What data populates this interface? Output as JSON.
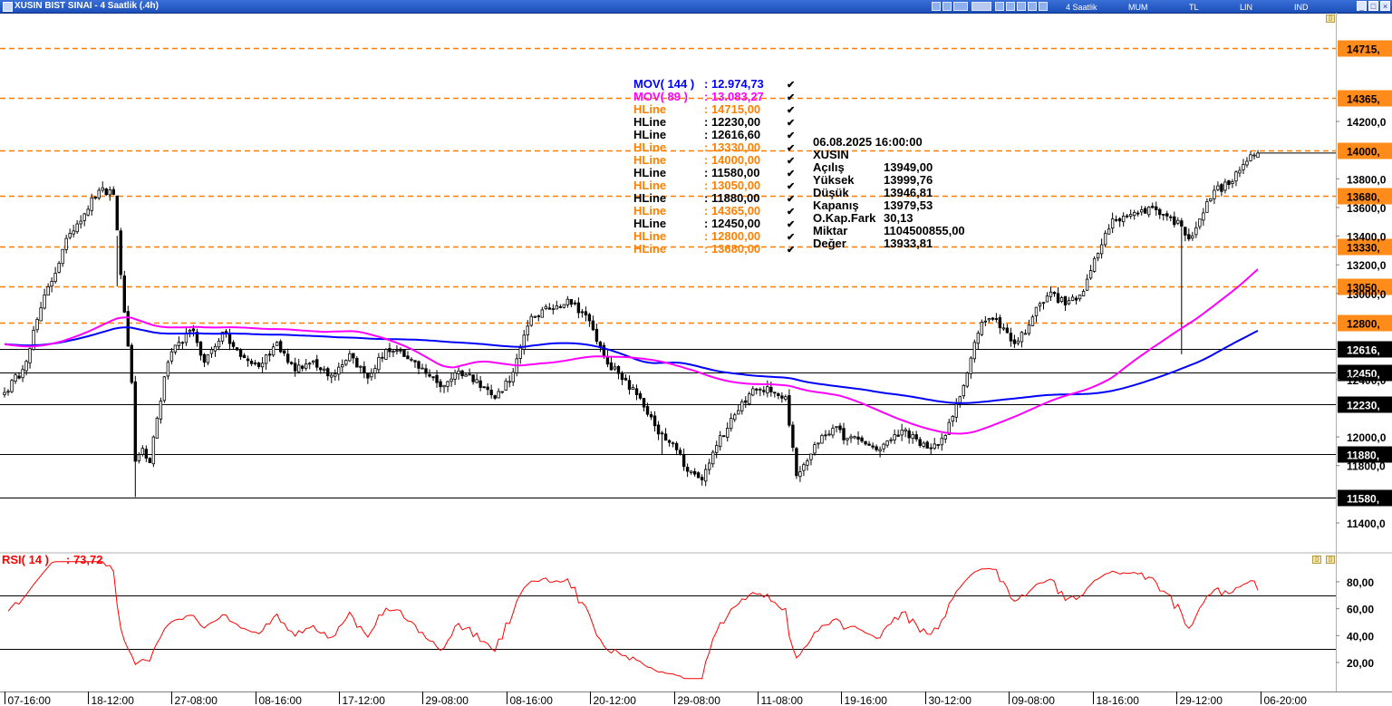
{
  "window": {
    "title": "XUSIN BIST SINAI - 4 Saatlik (.4h)",
    "toolbar": {
      "period": "4 Saatlik",
      "style": "MUM",
      "currency": "TL",
      "scale": "LIN",
      "indicators": "IND"
    }
  },
  "chart_data": {
    "type": "candlestick",
    "symbol": "XUSIN",
    "price_ticks": [
      "14200,0",
      "14000,",
      "13800,0",
      "13600,0",
      "13400,0",
      "13200,0",
      "13000,0",
      "12400,0",
      "12000,0",
      "11800,0",
      "11400,0"
    ],
    "x_labels": [
      "07-16:00",
      "18-12:00",
      "27-08:00",
      "08-16:00",
      "17-12:00",
      "29-08:00",
      "08-16:00",
      "20-12:00",
      "29-08:00",
      "11-08:00",
      "19-16:00",
      "30-12:00",
      "09-08:00",
      "18-16:00",
      "29-12:00",
      "06-20:00"
    ],
    "close_anchors": [
      [
        0,
        12310
      ],
      [
        5,
        12470
      ],
      [
        10,
        12900
      ],
      [
        18,
        13420
      ],
      [
        26,
        13720
      ],
      [
        30,
        13690
      ],
      [
        33,
        12870
      ],
      [
        35,
        12380
      ],
      [
        36,
        11830
      ],
      [
        38,
        11920
      ],
      [
        40,
        11820
      ],
      [
        42,
        12130
      ],
      [
        45,
        12520
      ],
      [
        48,
        12660
      ],
      [
        52,
        12740
      ],
      [
        55,
        12520
      ],
      [
        60,
        12730
      ],
      [
        65,
        12560
      ],
      [
        70,
        12490
      ],
      [
        75,
        12660
      ],
      [
        80,
        12460
      ],
      [
        85,
        12530
      ],
      [
        90,
        12430
      ],
      [
        95,
        12580
      ],
      [
        100,
        12410
      ],
      [
        105,
        12610
      ],
      [
        110,
        12560
      ],
      [
        115,
        12480
      ],
      [
        120,
        12350
      ],
      [
        125,
        12460
      ],
      [
        130,
        12400
      ],
      [
        135,
        12270
      ],
      [
        140,
        12450
      ],
      [
        145,
        12840
      ],
      [
        150,
        12890
      ],
      [
        155,
        12960
      ],
      [
        160,
        12850
      ],
      [
        165,
        12560
      ],
      [
        170,
        12400
      ],
      [
        175,
        12270
      ],
      [
        180,
        12020
      ],
      [
        185,
        11910
      ],
      [
        188,
        11760
      ],
      [
        192,
        11700
      ],
      [
        196,
        11940
      ],
      [
        200,
        12130
      ],
      [
        205,
        12300
      ],
      [
        210,
        12350
      ],
      [
        215,
        12280
      ],
      [
        218,
        11730
      ],
      [
        222,
        11880
      ],
      [
        225,
        12010
      ],
      [
        228,
        12060
      ],
      [
        232,
        11990
      ],
      [
        236,
        11970
      ],
      [
        240,
        11910
      ],
      [
        244,
        11980
      ],
      [
        248,
        12050
      ],
      [
        252,
        11940
      ],
      [
        255,
        11920
      ],
      [
        259,
        12010
      ],
      [
        263,
        12280
      ],
      [
        266,
        12550
      ],
      [
        269,
        12800
      ],
      [
        272,
        12820
      ],
      [
        275,
        12760
      ],
      [
        278,
        12650
      ],
      [
        282,
        12780
      ],
      [
        285,
        12930
      ],
      [
        288,
        13010
      ],
      [
        292,
        12920
      ],
      [
        296,
        12990
      ],
      [
        298,
        13100
      ],
      [
        302,
        13340
      ],
      [
        305,
        13520
      ],
      [
        308,
        13540
      ],
      [
        312,
        13560
      ],
      [
        316,
        13600
      ],
      [
        320,
        13540
      ],
      [
        324,
        13470
      ],
      [
        326,
        13380
      ],
      [
        329,
        13520
      ],
      [
        333,
        13720
      ],
      [
        337,
        13760
      ],
      [
        341,
        13900
      ],
      [
        345,
        13979.53
      ]
    ],
    "hlines": [
      {
        "label": "HLine",
        "value": "14715,00",
        "tag": "14715,",
        "price": 14715,
        "color": "#ff8000",
        "dashed": true
      },
      {
        "label": "HLine",
        "value": "12230,00",
        "tag": "12230,",
        "price": 12230,
        "color": "#000000",
        "dashed": false
      },
      {
        "label": "HLine",
        "value": "12616,60",
        "tag": "12616,",
        "price": 12616.6,
        "color": "#000000",
        "dashed": false
      },
      {
        "label": "HLine",
        "value": "13330,00",
        "tag": "13330,",
        "price": 13330,
        "color": "#ff8000",
        "dashed": true
      },
      {
        "label": "HLine",
        "value": "14000,00",
        "tag": "14000,",
        "price": 14000,
        "color": "#ff8000",
        "dashed": true
      },
      {
        "label": "HLine",
        "value": "11580,00",
        "tag": "11580,",
        "price": 11580,
        "color": "#000000",
        "dashed": false
      },
      {
        "label": "HLine",
        "value": "13050,00",
        "tag": "13050,",
        "price": 13050,
        "color": "#ff8000",
        "dashed": true
      },
      {
        "label": "HLine",
        "value": "11880,00",
        "tag": "11880,",
        "price": 11880,
        "color": "#000000",
        "dashed": false
      },
      {
        "label": "HLine",
        "value": "14365,00",
        "tag": "14365,",
        "price": 14365,
        "color": "#ff8000",
        "dashed": true
      },
      {
        "label": "HLine",
        "value": "12450,00",
        "tag": "12450,",
        "price": 12450,
        "color": "#000000",
        "dashed": false
      },
      {
        "label": "HLine",
        "value": "12800,00",
        "tag": "12800,",
        "price": 12800,
        "color": "#ff8000",
        "dashed": true
      },
      {
        "label": "HLine",
        "value": "13680,00",
        "tag": "13680,",
        "price": 13680,
        "color": "#ff8000",
        "dashed": true
      }
    ],
    "moving_averages": [
      {
        "label": "MOV( 144 )",
        "value": "12.974,73",
        "period": 144,
        "color": "#0000ff"
      },
      {
        "label": "MOV( 89 )",
        "value": "13.083,27",
        "period": 89,
        "color": "#ff00ff"
      }
    ],
    "info_box": {
      "datetime": "06.08.2025  16:00:00",
      "symbol": "XUSIN",
      "rows": [
        {
          "k": "Açılış",
          "v": "13949,00"
        },
        {
          "k": "Yüksek",
          "v": "13999,76"
        },
        {
          "k": "Düşük",
          "v": "13946,81"
        },
        {
          "k": "Kapanış",
          "v": "13979,53"
        },
        {
          "k": "O.Kap.Fark",
          "v": "30,13"
        },
        {
          "k": "Miktar",
          "v": "1104500855,00"
        },
        {
          "k": "Değer",
          "v": "13933,81"
        }
      ]
    },
    "rsi": {
      "label": "RSI( 14 )",
      "value": ": 73,72",
      "period": 14,
      "color": "#ff0000",
      "ticks": [
        "80,00",
        "60,00",
        "40,00",
        "20,00"
      ],
      "levels": [
        70,
        30
      ]
    }
  }
}
